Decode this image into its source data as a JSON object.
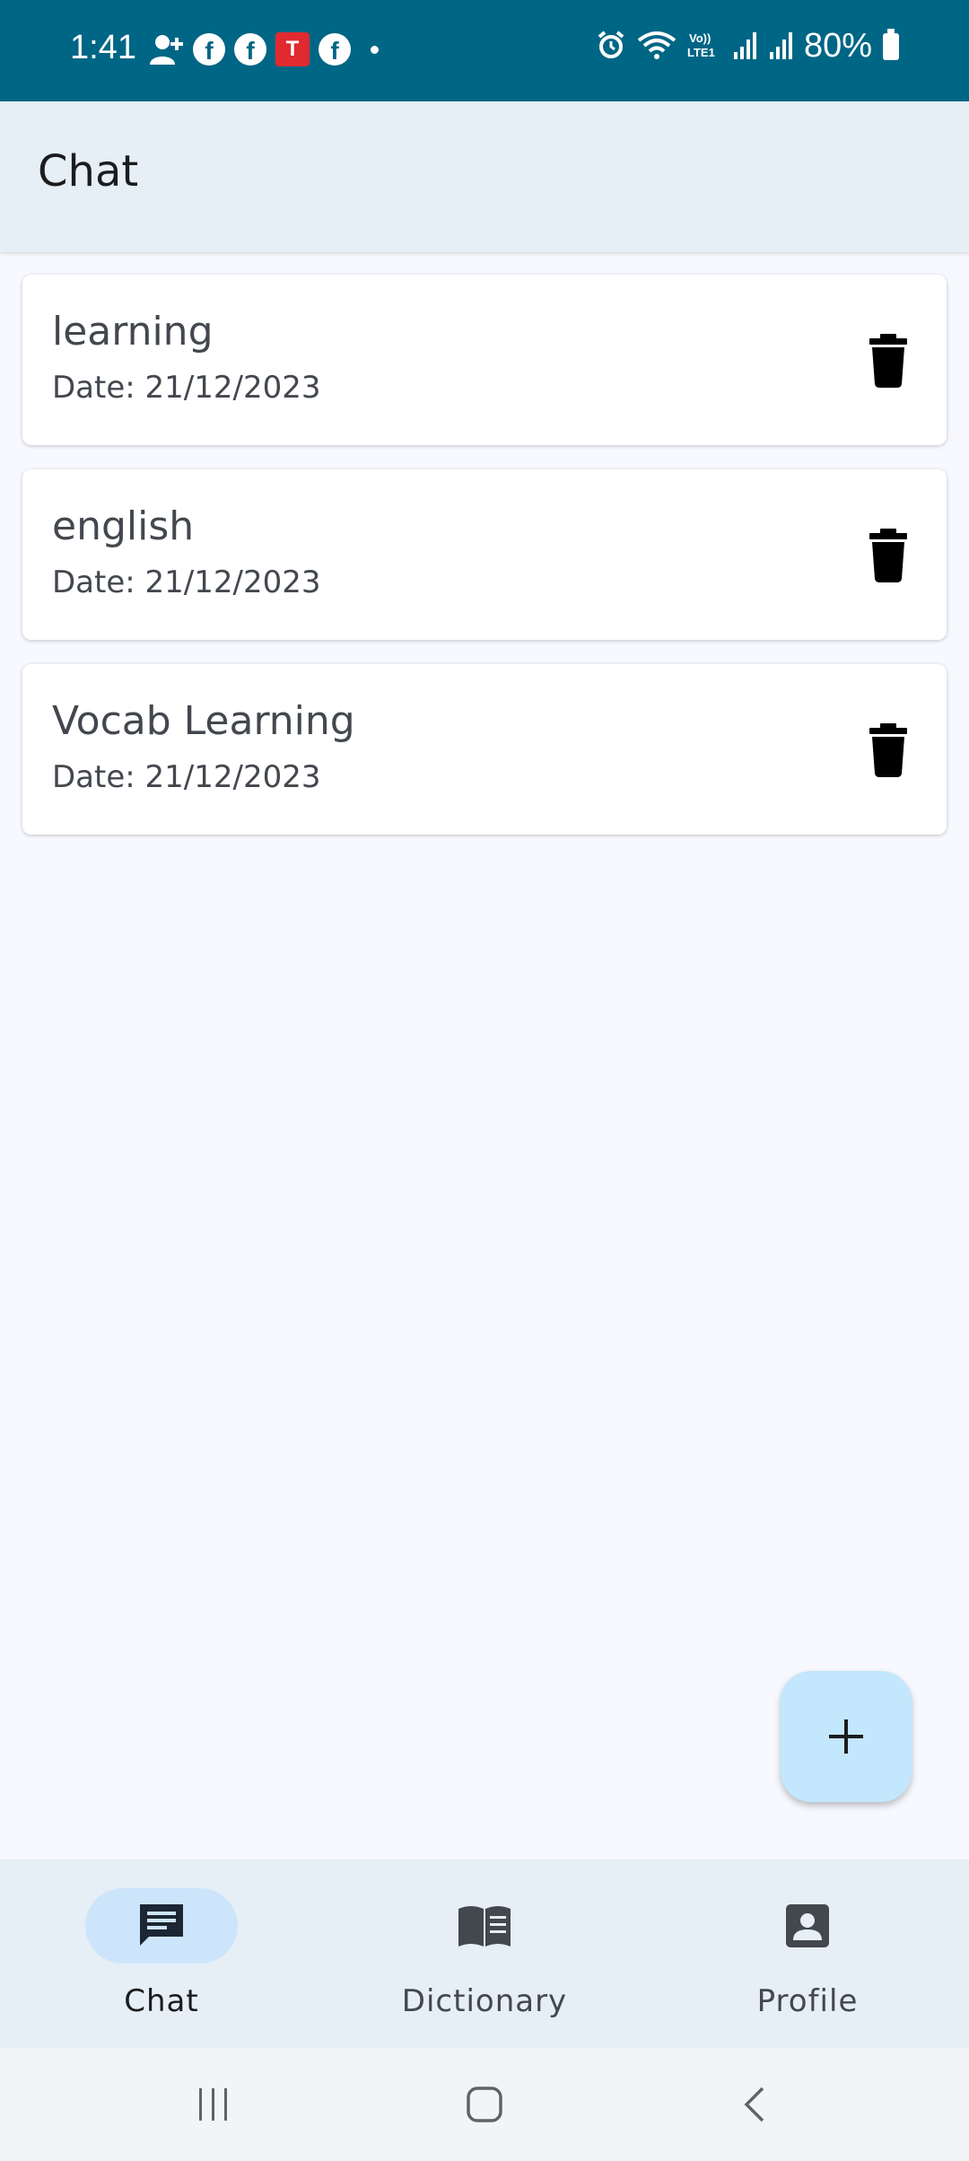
{
  "status_bar": {
    "time": "1:41",
    "battery": "80%",
    "left_icons": [
      "add-person-icon",
      "facebook-icon",
      "facebook-icon",
      "t-app-icon",
      "facebook-icon",
      "dot-icon"
    ],
    "right_icons": [
      "alarm-icon",
      "wifi-icon",
      "volte-icon",
      "signal-icon",
      "signal-icon",
      "battery-icon"
    ],
    "t_icon_glyph": "T",
    "fb_glyph": "f"
  },
  "app_bar": {
    "title": "Chat"
  },
  "chats": [
    {
      "title": "learning",
      "date": "Date: 21/12/2023"
    },
    {
      "title": "english",
      "date": "Date: 21/12/2023"
    },
    {
      "title": "Vocab Learning",
      "date": "Date: 21/12/2023"
    }
  ],
  "fab": {
    "icon": "plus-icon"
  },
  "bottom_nav": {
    "items": [
      {
        "label": "Chat",
        "icon": "chat-icon",
        "active": true
      },
      {
        "label": "Dictionary",
        "icon": "book-icon",
        "active": false
      },
      {
        "label": "Profile",
        "icon": "profile-icon",
        "active": false
      }
    ]
  },
  "colors": {
    "status_bar": "#006685",
    "app_bar": "#e6eef6",
    "background": "#f7f9fe",
    "fab": "#c3e7fd",
    "nav_active_pill": "#cde5fb"
  }
}
